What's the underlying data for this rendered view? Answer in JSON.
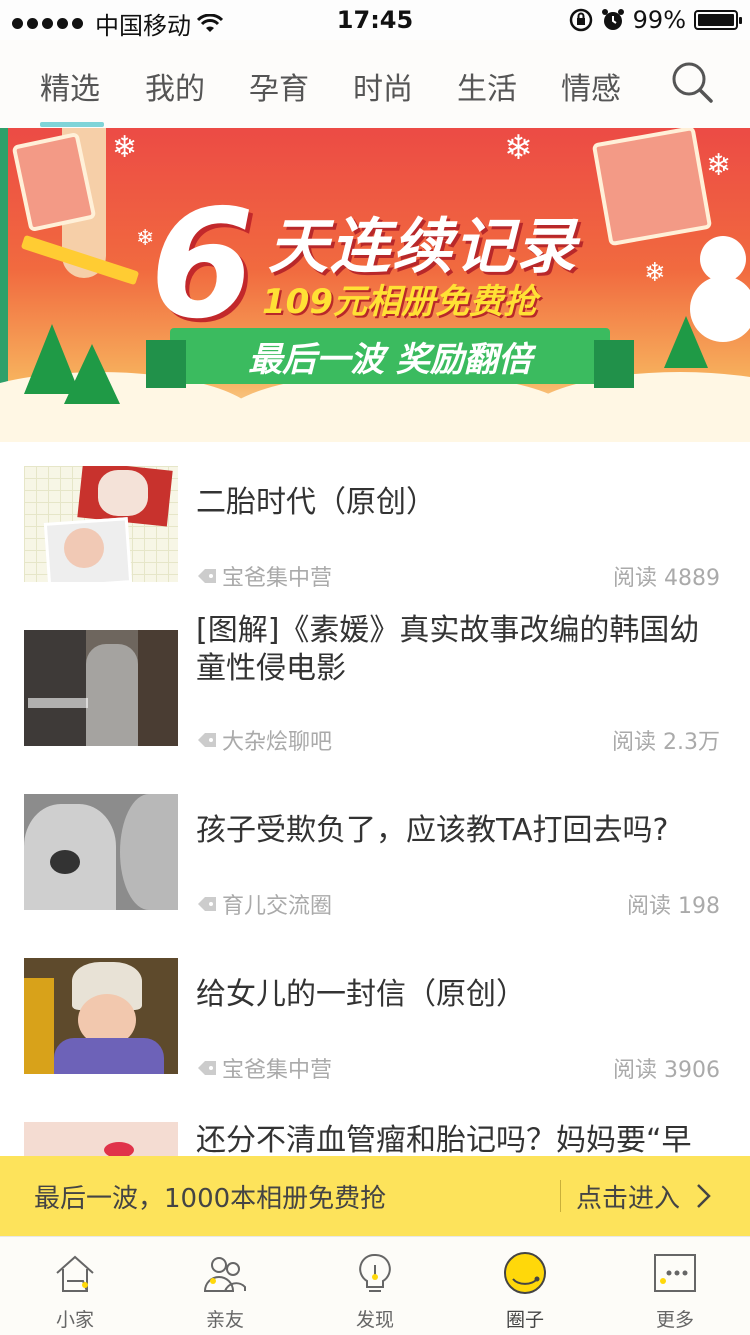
{
  "status_bar": {
    "carrier": "中国移动",
    "time": "17:45",
    "battery": "99%",
    "battery_level": 0.99
  },
  "top_tabs": [
    {
      "label": "精选",
      "active": true
    },
    {
      "label": "我的",
      "active": false
    },
    {
      "label": "孕育",
      "active": false
    },
    {
      "label": "时尚",
      "active": false
    },
    {
      "label": "生活",
      "active": false
    },
    {
      "label": "情感",
      "active": false
    }
  ],
  "banner": {
    "number": "6",
    "title": "天连续记录",
    "subtitle": "109元相册免费抢",
    "ribbon": "最后一波 奖励翻倍",
    "pages": 3,
    "current_page": 3
  },
  "posts": [
    {
      "title": "二胎时代（原创）",
      "tag": "宝爸集中营",
      "reads": "阅读 4889"
    },
    {
      "title": "[图解]《素媛》真实故事改编的韩国幼童性侵电影",
      "tag": "大杂烩聊吧",
      "reads": "阅读 2.3万"
    },
    {
      "title": "孩子受欺负了，应该教TA打回去吗?",
      "tag": "育儿交流圈",
      "reads": "阅读 198"
    },
    {
      "title": "给女儿的一封信（原创）",
      "tag": "宝爸集中营",
      "reads": "阅读 3906"
    },
    {
      "title": "还分不清血管瘤和胎记吗？妈妈要“早",
      "tag": "",
      "reads": ""
    }
  ],
  "promo": {
    "text": "最后一波，1000本相册免费抢",
    "action": "点击进入"
  },
  "tab_bar": [
    {
      "label": "小家",
      "icon": "home-icon",
      "active": false
    },
    {
      "label": "亲友",
      "icon": "friends-icon",
      "active": false
    },
    {
      "label": "发现",
      "icon": "discover-icon",
      "active": false
    },
    {
      "label": "圈子",
      "icon": "circle-icon",
      "active": true
    },
    {
      "label": "更多",
      "icon": "more-icon",
      "active": false
    }
  ],
  "colors": {
    "accent_teal": "#7fd4d8",
    "promo_yellow": "#fde35b",
    "active_circle": "#ffd80a"
  }
}
